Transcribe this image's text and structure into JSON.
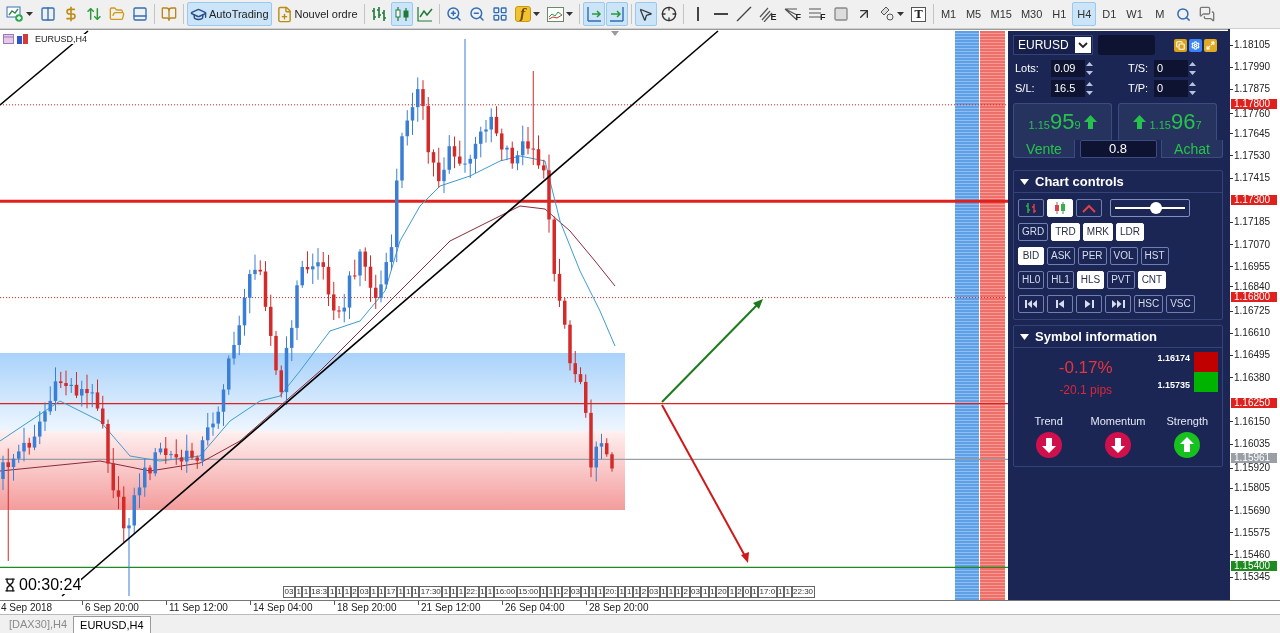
{
  "toolbar": {
    "autotrading": {
      "label": "AutoTrading",
      "on": true
    },
    "new_order": {
      "label": "Nouvel ordre"
    },
    "chart_types": [
      {
        "selected": false
      },
      {
        "selected": true
      },
      {
        "selected": false
      }
    ],
    "indicator_glyph": "f",
    "view_toggles": [
      {
        "on": true
      },
      {
        "on": true
      }
    ],
    "pointer_modes": [
      {
        "selected": true
      },
      {
        "selected": false
      }
    ],
    "fibo_badges": [
      "E",
      "F",
      "F"
    ],
    "text_tool_glyph": "T",
    "timeframes": [
      {
        "label": "M1",
        "selected": false
      },
      {
        "label": "M5",
        "selected": false
      },
      {
        "label": "M15",
        "selected": false
      },
      {
        "label": "M30",
        "selected": false
      },
      {
        "label": "H1",
        "selected": false
      },
      {
        "label": "H4",
        "selected": true
      },
      {
        "label": "D1",
        "selected": false
      },
      {
        "label": "W1",
        "selected": false
      },
      {
        "label": "M",
        "selected": false
      }
    ]
  },
  "chart": {
    "title": "EURUSD,H4",
    "countdown": "00:30:24",
    "price_axis": [
      "1.18105",
      "1.17990",
      "1.17875",
      "1.17760",
      "1.17645",
      "1.17530",
      "1.17415",
      "1.17185",
      "1.17070",
      "1.16955",
      "1.16840",
      "1.16725",
      "1.16610",
      "1.16495",
      "1.16380",
      "1.16150",
      "1.16035",
      "1.15920",
      "1.15805",
      "1.15690",
      "1.15575",
      "1.15460",
      "1.15345"
    ],
    "price_lines": [
      {
        "label": "1.17800",
        "kind": "dotted",
        "color": "#e0201c"
      },
      {
        "label": "1.17300",
        "kind": "thick",
        "color": "#e0201c"
      },
      {
        "label": "1.16800",
        "kind": "dotted",
        "color": "#e0201c"
      },
      {
        "label": "1.16250",
        "kind": "solid",
        "color": "#e0201c"
      },
      {
        "label": "1.15961",
        "kind": "solid",
        "color": "#9a9ea6"
      },
      {
        "label": "1.15400",
        "kind": "solid",
        "color": "#1f8a1f"
      }
    ],
    "time_axis": [
      "4 Sep 2018",
      "6 Sep 20:00",
      "11 Sep 12:00",
      "14 Sep 04:00",
      "18 Sep 20:00",
      "21 Sep 12:00",
      "26 Sep 04:00",
      "28 Sep 20:00"
    ],
    "session_labels": [
      "03",
      "1",
      "1",
      "18:3",
      "1",
      "1",
      "1",
      "2",
      "03",
      "1",
      "1",
      "17",
      "1",
      "1",
      "1",
      "17:30",
      "1",
      "1",
      "1",
      "22:",
      "1",
      "1",
      "16:00",
      "15:00",
      "1",
      "1",
      "1",
      "2",
      "03",
      "1",
      "1",
      "1",
      "20:",
      "1",
      "1",
      "1",
      "2",
      "03",
      "1",
      "1",
      "1",
      "2",
      "03",
      "1",
      "1",
      "20",
      "1",
      "2",
      "0",
      "1",
      "17:0",
      "1",
      "1",
      "22:30"
    ]
  },
  "trade_panel": {
    "symbol": "EURUSD",
    "fields": [
      {
        "label": "Lots:",
        "value": "0.09"
      },
      {
        "label": "T/S:",
        "value": "0"
      },
      {
        "label": "S/L:",
        "value": "16.5"
      },
      {
        "label": "T/P:",
        "value": "0"
      }
    ],
    "quotes": [
      {
        "lead": "1.15",
        "big": "95",
        "tail": "9",
        "rising": true,
        "label": "Vente"
      },
      {
        "lead": "1.15",
        "big": "96",
        "tail": "7",
        "rising": true,
        "label": "Achat"
      }
    ],
    "spread": "0.8"
  },
  "chart_controls": {
    "title": "Chart controls",
    "expanded": true,
    "view_buttons": [
      {
        "on": false
      },
      {
        "on": true
      },
      {
        "on": false
      }
    ],
    "zoom": {
      "level": 0.58
    },
    "rows": [
      [
        {
          "label": "GRD",
          "on": false
        },
        {
          "label": "TRD",
          "on": true
        },
        {
          "label": "MRK",
          "on": true
        },
        {
          "label": "LDR",
          "on": true
        }
      ],
      [
        {
          "label": "BID",
          "on": true
        },
        {
          "label": "ASK",
          "on": false
        },
        {
          "label": "PER",
          "on": false
        },
        {
          "label": "VOL",
          "on": false
        },
        {
          "label": "HST",
          "on": false
        }
      ],
      [
        {
          "label": "HL0",
          "on": false
        },
        {
          "label": "HL1",
          "on": false
        },
        {
          "label": "HLS",
          "on": true
        },
        {
          "label": "PVT",
          "on": false
        },
        {
          "label": "CNT",
          "on": true
        }
      ]
    ],
    "nav_buttons": [
      {
        "on": false
      },
      {
        "on": false
      },
      {
        "on": false
      },
      {
        "on": false
      }
    ],
    "scale_buttons": [
      {
        "label": "HSC",
        "on": false
      },
      {
        "label": "VSC",
        "on": false
      }
    ]
  },
  "symbol_info": {
    "title": "Symbol information",
    "expanded": true,
    "change": "-0.17%",
    "pips": "-20.1 pips",
    "range": [
      {
        "value": "1.16174",
        "color": "#c00000"
      },
      {
        "value": "1.15735",
        "color": "#00b300"
      }
    ],
    "indicators": [
      {
        "label": "Trend",
        "rising": false
      },
      {
        "label": "Momentum",
        "rising": false
      },
      {
        "label": "Strength",
        "rising": true
      }
    ]
  },
  "tabs": [
    {
      "label": "[DAX30],H4",
      "selected": false
    },
    {
      "label": "EURUSD,H4",
      "selected": true
    }
  ]
}
